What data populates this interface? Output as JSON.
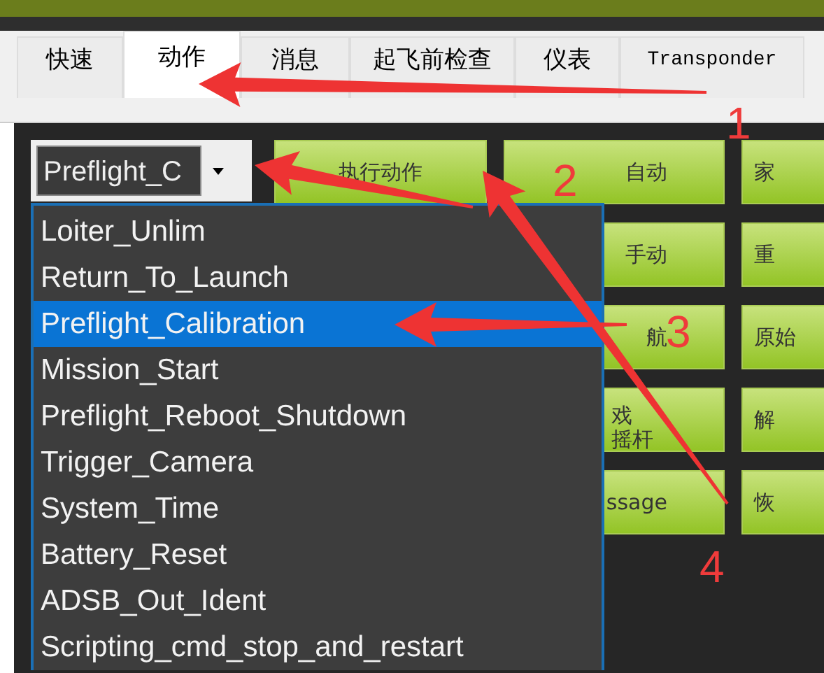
{
  "tabs": [
    {
      "label": "快速",
      "selected": false
    },
    {
      "label": "动作",
      "selected": true
    },
    {
      "label": "消息",
      "selected": false
    },
    {
      "label": "起飞前检查",
      "selected": false
    },
    {
      "label": "仪表",
      "selected": false
    },
    {
      "label": "Transponder",
      "selected": false
    }
  ],
  "action_combo": {
    "value": "Preflight_C",
    "expanded": true,
    "options": [
      {
        "label": "Loiter_Unlim",
        "selected": false
      },
      {
        "label": "Return_To_Launch",
        "selected": false
      },
      {
        "label": "Preflight_Calibration",
        "selected": true
      },
      {
        "label": "Mission_Start",
        "selected": false
      },
      {
        "label": "Preflight_Reboot_Shutdown",
        "selected": false
      },
      {
        "label": "Trigger_Camera",
        "selected": false
      },
      {
        "label": "System_Time",
        "selected": false
      },
      {
        "label": "Battery_Reset",
        "selected": false
      },
      {
        "label": "ADSB_Out_Ident",
        "selected": false
      },
      {
        "label": "Scripting_cmd_stop_and_restart",
        "selected": false
      }
    ]
  },
  "buttons": [
    {
      "col_1": "执行动作",
      "col_2": "自动",
      "col_3": "家"
    },
    {
      "col_2": "手动",
      "col_3": "重"
    },
    {
      "col_2": "航",
      "col_3": "原始"
    },
    {
      "col_2": [
        "戏",
        "摇杆"
      ],
      "col_3": "解"
    },
    {
      "col_2": "ssage",
      "col_3": "恢"
    }
  ],
  "annotations": [
    {
      "number": "1"
    },
    {
      "number": "2"
    },
    {
      "number": "3"
    },
    {
      "number": "4"
    }
  ]
}
